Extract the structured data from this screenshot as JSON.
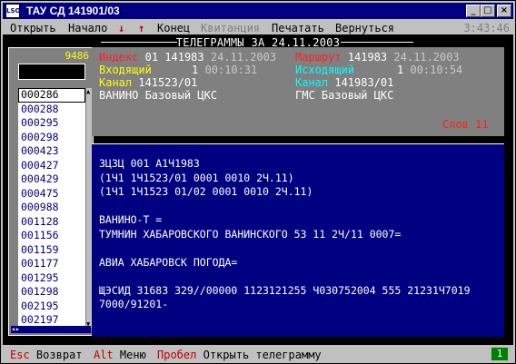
{
  "window": {
    "icon_text": "LSO",
    "title": "ТАУ СД 141901/03",
    "btn_min": "_",
    "btn_max": "□",
    "btn_close": "×"
  },
  "menu": {
    "open": "Открыть",
    "start": "Начало",
    "down": "↓",
    "up": "↑",
    "end": "Конец",
    "receipt": "Квитанция",
    "print": "Печатать",
    "back": "Вернуться",
    "clock": "3:43:46"
  },
  "main_title": "ТЕЛЕГРАММЫ ЗА 24.11.2003",
  "list": {
    "count": "9486",
    "items": [
      "000286",
      "000288",
      "000295",
      "000298",
      "000423",
      "000427",
      "000429",
      "000475",
      "000988",
      "001128",
      "001156",
      "001159",
      "001177",
      "001295",
      "001298",
      "002195",
      "002197"
    ],
    "selected_index": 0
  },
  "header": {
    "index_label": "Индекс",
    "index_value": "01 141983",
    "index_date": "24.11.2003",
    "route_label": "Маршрут",
    "route_value": "141983",
    "route_date": "24.11.2003",
    "incoming_label": "Входящий",
    "incoming_num": "1",
    "incoming_time": "00:10:31",
    "outgoing_label": "Исходящий",
    "outgoing_num": "1",
    "outgoing_time": "00:10:54",
    "channel_label": "Канал",
    "channel_in": "141523/01",
    "channel_label2": "Канал",
    "channel_out": "141983/01",
    "src_station": "ВАНИНО Базовый ЦКС",
    "dst_station": "ГМС Базовый ЦКС",
    "words_label": "Слов",
    "words_count": "11"
  },
  "body_text": "ЗЦЗЦ 001 А1Ч1983\n(1Ч1 1Ч1523/01 0001 0010 2Ч.11)\n(1Ч1 1Ч1523 01/02 0001 0010 2Ч.11)\n\nВАНИНО-Т =\nТУМНИН ХАБАРОВСКОГО ВАНИНСКОГО 53 11 2Ч/11 0007=\n\nАВИА ХАБАРОВСК ПОГОДА=\n\nЩЭСИД 31683 329//00000 1123121255 Ч030752004 555 21231Ч7019\n7000/91201-",
  "status": {
    "esc_key": "Esc",
    "esc_label": "Возврат",
    "alt_key": "Alt",
    "alt_label": "Меню",
    "space_key": "Пробел",
    "space_label": "Открыть телеграмму",
    "indicator": "1"
  }
}
